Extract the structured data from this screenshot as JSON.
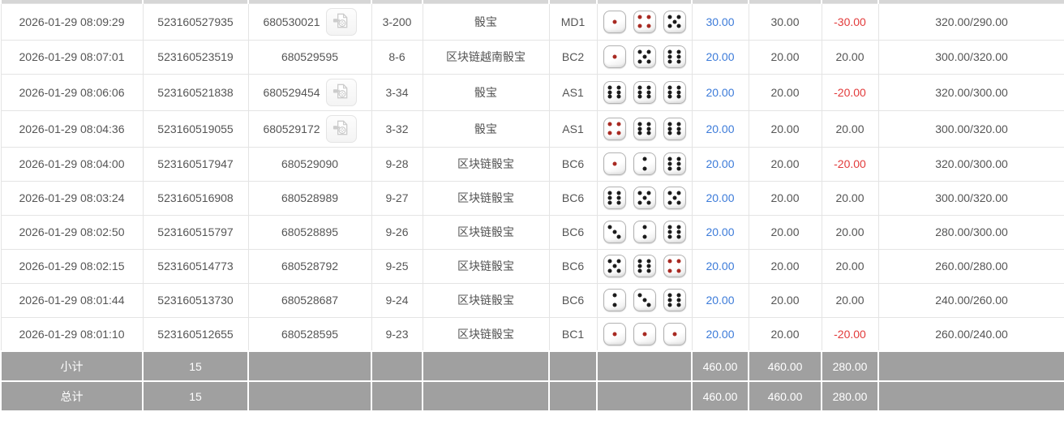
{
  "colors": {
    "link_blue": "#3c7bd9",
    "loss_red": "#e23b3b",
    "footer_grey": "#a0a0a0",
    "body_text": "#555555",
    "border": "#e4e4e4"
  },
  "icons": {
    "video_replay": "video-file-icon",
    "dice": "die-icon"
  },
  "table": {
    "rows": [
      {
        "time": "2026-01-29 08:09:29",
        "serial": "523160527935",
        "round": "680530021",
        "has_video": true,
        "period": "3-200",
        "game": "骰宝",
        "table_code": "MD1",
        "dice": [
          1,
          4,
          5
        ],
        "bet": "30.00",
        "valid": "30.00",
        "profit": "-30.00",
        "balance": "320.00/290.00"
      },
      {
        "time": "2026-01-29 08:07:01",
        "serial": "523160523519",
        "round": "680529595",
        "has_video": false,
        "period": "8-6",
        "game": "区块链越南骰宝",
        "table_code": "BC2",
        "dice": [
          1,
          5,
          6
        ],
        "bet": "20.00",
        "valid": "20.00",
        "profit": "20.00",
        "balance": "300.00/320.00"
      },
      {
        "time": "2026-01-29 08:06:06",
        "serial": "523160521838",
        "round": "680529454",
        "has_video": true,
        "period": "3-34",
        "game": "骰宝",
        "table_code": "AS1",
        "dice": [
          6,
          6,
          6
        ],
        "bet": "20.00",
        "valid": "20.00",
        "profit": "-20.00",
        "balance": "320.00/300.00"
      },
      {
        "time": "2026-01-29 08:04:36",
        "serial": "523160519055",
        "round": "680529172",
        "has_video": true,
        "period": "3-32",
        "game": "骰宝",
        "table_code": "AS1",
        "dice": [
          4,
          6,
          6
        ],
        "bet": "20.00",
        "valid": "20.00",
        "profit": "20.00",
        "balance": "300.00/320.00"
      },
      {
        "time": "2026-01-29 08:04:00",
        "serial": "523160517947",
        "round": "680529090",
        "has_video": false,
        "period": "9-28",
        "game": "区块链骰宝",
        "table_code": "BC6",
        "dice": [
          1,
          2,
          6
        ],
        "bet": "20.00",
        "valid": "20.00",
        "profit": "-20.00",
        "balance": "320.00/300.00"
      },
      {
        "time": "2026-01-29 08:03:24",
        "serial": "523160516908",
        "round": "680528989",
        "has_video": false,
        "period": "9-27",
        "game": "区块链骰宝",
        "table_code": "BC6",
        "dice": [
          6,
          5,
          5
        ],
        "bet": "20.00",
        "valid": "20.00",
        "profit": "20.00",
        "balance": "300.00/320.00"
      },
      {
        "time": "2026-01-29 08:02:50",
        "serial": "523160515797",
        "round": "680528895",
        "has_video": false,
        "period": "9-26",
        "game": "区块链骰宝",
        "table_code": "BC6",
        "dice": [
          3,
          2,
          6
        ],
        "bet": "20.00",
        "valid": "20.00",
        "profit": "20.00",
        "balance": "280.00/300.00"
      },
      {
        "time": "2026-01-29 08:02:15",
        "serial": "523160514773",
        "round": "680528792",
        "has_video": false,
        "period": "9-25",
        "game": "区块链骰宝",
        "table_code": "BC6",
        "dice": [
          5,
          6,
          4
        ],
        "bet": "20.00",
        "valid": "20.00",
        "profit": "20.00",
        "balance": "260.00/280.00"
      },
      {
        "time": "2026-01-29 08:01:44",
        "serial": "523160513730",
        "round": "680528687",
        "has_video": false,
        "period": "9-24",
        "game": "区块链骰宝",
        "table_code": "BC6",
        "dice": [
          2,
          3,
          6
        ],
        "bet": "20.00",
        "valid": "20.00",
        "profit": "20.00",
        "balance": "240.00/260.00"
      },
      {
        "time": "2026-01-29 08:01:10",
        "serial": "523160512655",
        "round": "680528595",
        "has_video": false,
        "period": "9-23",
        "game": "区块链骰宝",
        "table_code": "BC1",
        "dice": [
          1,
          1,
          1
        ],
        "bet": "20.00",
        "valid": "20.00",
        "profit": "-20.00",
        "balance": "260.00/240.00"
      }
    ],
    "footer": {
      "rows": [
        {
          "label": "小计",
          "count": "15",
          "bet_total": "460.00",
          "valid_total": "460.00",
          "profit_total": "280.00"
        },
        {
          "label": "总计",
          "count": "15",
          "bet_total": "460.00",
          "valid_total": "460.00",
          "profit_total": "280.00"
        }
      ]
    }
  }
}
